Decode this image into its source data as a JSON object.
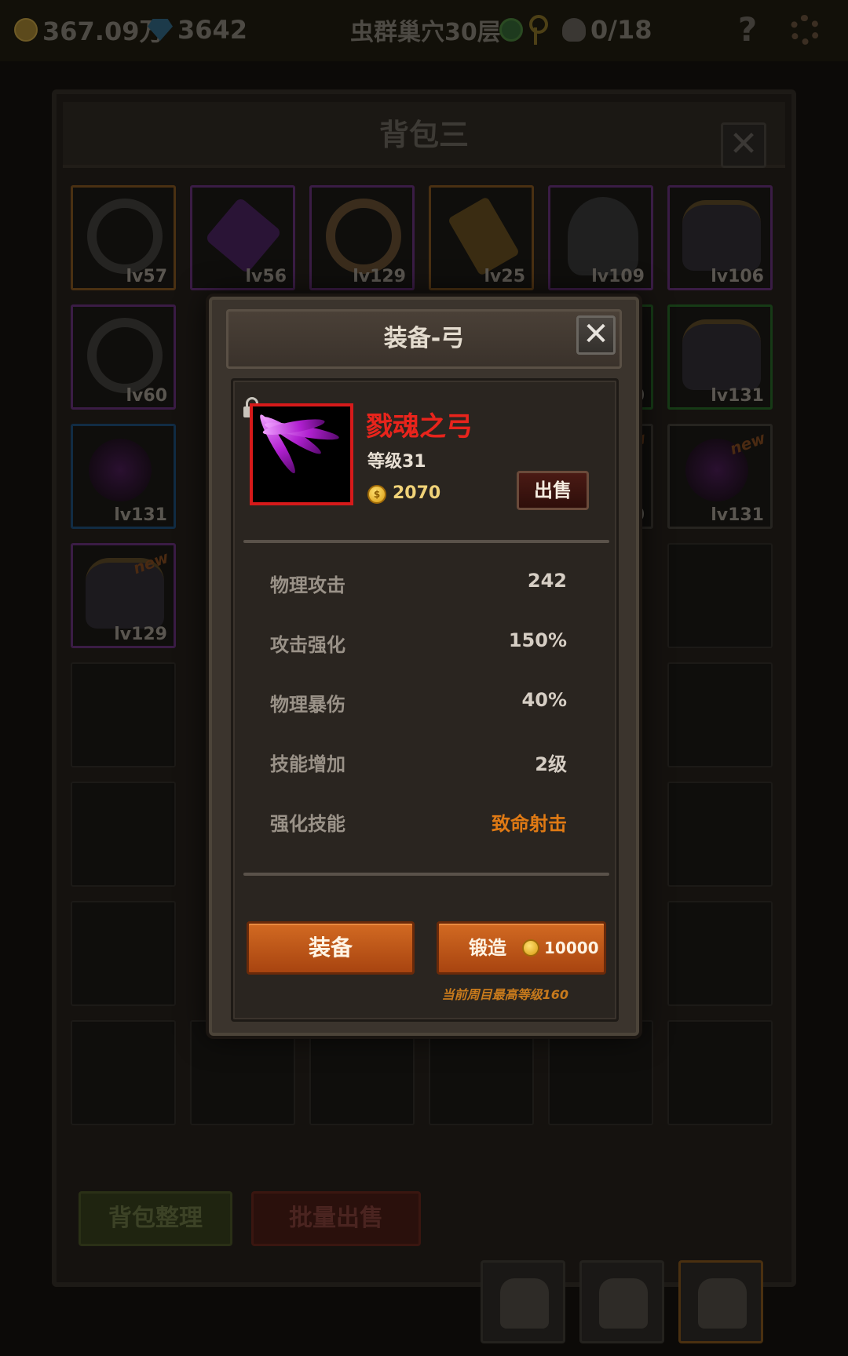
{
  "topbar": {
    "gold": "367.09万",
    "gems": "3642",
    "location": "虫群巢穴30层",
    "skull_count": "0/18",
    "help": "?"
  },
  "bag": {
    "title": "背包三",
    "close": "✕",
    "slots": [
      {
        "lv": "lv57"
      },
      {
        "lv": "lv56"
      },
      {
        "lv": "lv129"
      },
      {
        "lv": "lv25"
      },
      {
        "lv": "lv109"
      },
      {
        "lv": "lv106"
      },
      {
        "lv": "lv60"
      },
      {
        "lv": "0"
      },
      {
        "lv": "lv131"
      },
      {
        "lv": "lv131"
      },
      {
        "lv": "0"
      },
      {
        "lv": "lv131"
      },
      {
        "lv": "lv129"
      }
    ],
    "new_badge": "new",
    "tidy_button": "背包整理",
    "batch_sell_button": "批量出售"
  },
  "popup": {
    "title": "装备-弓",
    "close": "✕",
    "item": {
      "name": "戮魂之弓",
      "level": "等级31",
      "price": "2070",
      "coin_symbol": "$",
      "sell_button": "出售"
    },
    "stats": [
      {
        "label": "物理攻击",
        "value": "242"
      },
      {
        "label": "攻击强化",
        "value": "150%"
      },
      {
        "label": "物理暴伤",
        "value": "40%"
      },
      {
        "label": "技能增加",
        "value": "2级"
      },
      {
        "label": "强化技能",
        "value": "致命射击"
      }
    ],
    "equip_button": "装备",
    "forge_button": "锻造",
    "forge_cost": "10000",
    "max_level_note": "当前周目最高等级160"
  },
  "colors": {
    "item_name": "#e8241c",
    "frame_border": "#d61a1a",
    "skill_value": "#e07a14",
    "button": "#c25a1a"
  }
}
